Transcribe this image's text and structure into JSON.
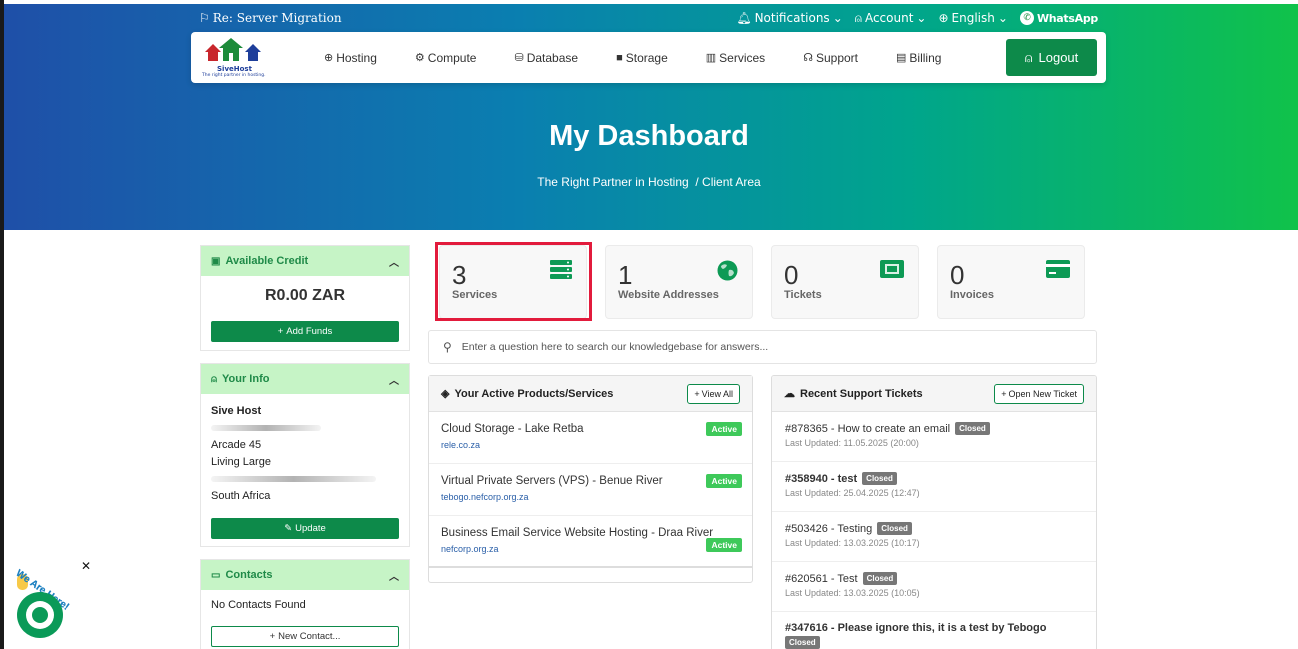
{
  "topbar": {
    "announcement": "Re: Server Migration",
    "notifications": "Notifications",
    "account": "Account",
    "language": "English",
    "whatsapp": "WhatsApp"
  },
  "logo": {
    "brand": "SiveHost",
    "tagline": "The right partner in hosting."
  },
  "nav": {
    "items": [
      "Hosting",
      "Compute",
      "Database",
      "Storage",
      "Services",
      "Support",
      "Billing"
    ],
    "logout": "Logout"
  },
  "hero": {
    "title": "My Dashboard",
    "crumb1": "The Right Partner in Hosting",
    "sep": "/",
    "crumb2": "Client Area"
  },
  "credit": {
    "title": "Available Credit",
    "amount": "R0.00 ZAR",
    "add_funds": "Add Funds"
  },
  "your_info": {
    "title": "Your Info",
    "name": "Sive Host",
    "line2": "Arcade 45",
    "line3": "Living Large",
    "country": "South Africa",
    "update": "Update"
  },
  "contacts": {
    "title": "Contacts",
    "empty": "No Contacts Found",
    "new_contact": "New Contact..."
  },
  "stats": [
    {
      "num": "3",
      "label": "Services"
    },
    {
      "num": "1",
      "label": "Website Addresses"
    },
    {
      "num": "0",
      "label": "Tickets"
    },
    {
      "num": "0",
      "label": "Invoices"
    }
  ],
  "kb": {
    "placeholder": "Enter a question here to search our knowledgebase for answers..."
  },
  "products": {
    "title": "Your Active Products/Services",
    "view_all": "View All",
    "rows": [
      {
        "name": "Cloud Storage - Lake Retba",
        "domain": "rele.co.za",
        "status": "Active"
      },
      {
        "name": "Virtual Private Servers (VPS) - Benue River",
        "domain": "tebogo.nefcorp.org.za",
        "status": "Active"
      },
      {
        "name": "Business Email Service Website Hosting - Draa River",
        "domain": "nefcorp.org.za",
        "status": "Active"
      }
    ]
  },
  "tickets": {
    "title": "Recent Support Tickets",
    "open_new": "Open New Ticket",
    "rows": [
      {
        "title": "#878365 - How to create an email",
        "status": "Closed",
        "updated": "Last Updated: 11.05.2025 (20:00)"
      },
      {
        "title": "#358940 - test",
        "status": "Closed",
        "updated": "Last Updated: 25.04.2025 (12:47)"
      },
      {
        "title": "#503426 - Testing",
        "status": "Closed",
        "updated": "Last Updated: 13.03.2025 (10:17)"
      },
      {
        "title": "#620561 - Test",
        "status": "Closed",
        "updated": "Last Updated: 13.03.2025 (10:05)"
      },
      {
        "title": "#347616 - Please ignore this, it is a test by Tebogo",
        "status": "Closed",
        "updated": ""
      }
    ]
  },
  "chat": {
    "label": "We Are Here!"
  },
  "colors": {
    "accent": "#0d8a4a",
    "panel_head": "#c6f4c6",
    "highlight": "#e21b3c",
    "badge_active": "#3ec95a"
  }
}
